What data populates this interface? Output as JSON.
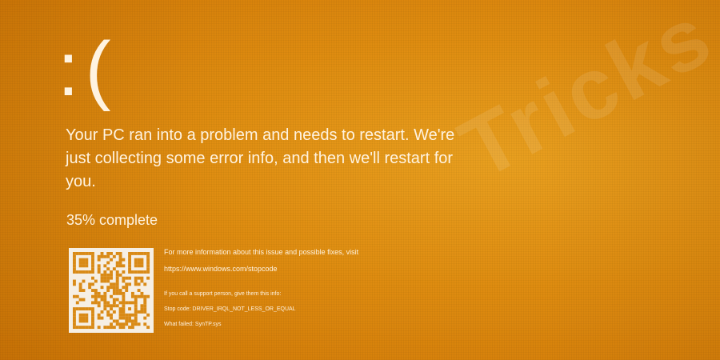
{
  "screen": {
    "face": ":(",
    "headline": "Your PC ran into a problem and needs to restart. We're just collecting some error info, and then we'll restart for you.",
    "progress": {
      "value": 35,
      "text": "35% complete"
    },
    "more_info_text": "For more information about this issue and possible fixes, visit",
    "url": "https://www.windows.com/stopcode",
    "support_text": "If you call a support person, give them this info:",
    "stop_code_text": "Stop code: DRIVER_IRQL_NOT_LESS_OR_EQUAL",
    "what_failed_text": "What failed: SynTP.sys"
  },
  "watermark": {
    "text": "Tricks"
  },
  "colors": {
    "background": "#df8c10",
    "foreground": "#fff3e0",
    "qr_dark": "#d98a16",
    "qr_light": "#f6efe4"
  },
  "icons": {
    "qr": "qr-code-icon",
    "sad_face": "sad-face-icon"
  }
}
